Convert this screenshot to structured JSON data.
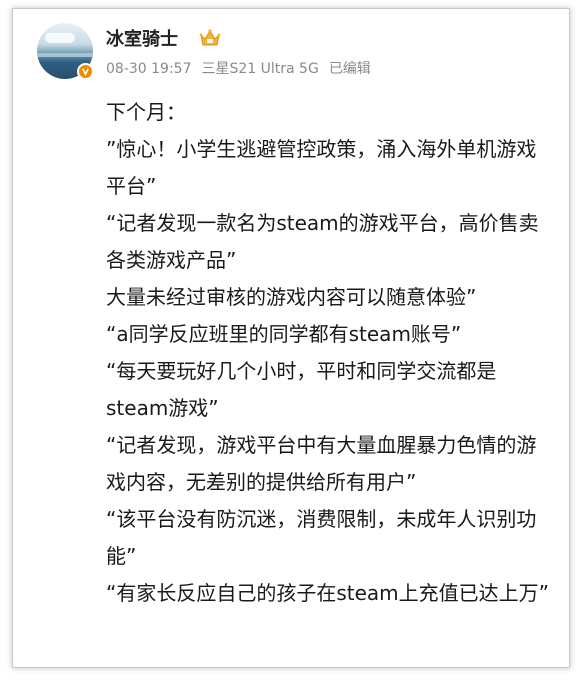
{
  "post": {
    "author": "冰室骑士",
    "date": "08-30 19:57",
    "device": "三星S21 Ultra 5G",
    "edited": "已编辑",
    "verified_badge_color": "#f08a00",
    "crown_color": "#f2b233",
    "lines": [
      "下个月：",
      "”惊心！小学生逃避管控政策，涌入海外单机游戏平台”",
      "“记者发现一款名为steam的游戏平台，高价售卖各类游戏产品”",
      "大量未经过审核的游戏内容可以随意体验”",
      "“a同学反应班里的同学都有steam账号”",
      "“每天要玩好几个小时，平时和同学交流都是steam游戏”",
      "“记者发现，游戏平台中有大量血腥暴力色情的游戏内容，无差别的提供给所有用户”",
      "“该平台没有防沉迷，消费限制，未成年人识别功能”",
      "“有家长反应自己的孩子在steam上充值已达上万”"
    ]
  }
}
